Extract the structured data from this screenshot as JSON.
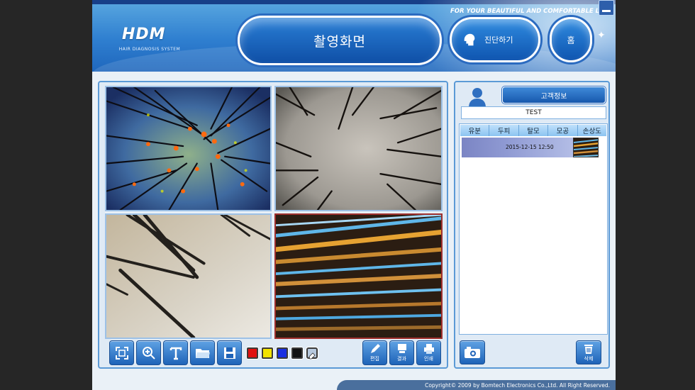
{
  "header": {
    "logo": "HDM",
    "logo_sub": "HAIR DIAGNOSIS SYSTEM",
    "slogan": "FOR YOUR BEAUTIFUL AND COMFORTABLE LIFE",
    "screen_title": "촬영화면",
    "diagnose_label": "진단하기",
    "home_label": "홈"
  },
  "toolbar": {
    "tools": [
      {
        "name": "fit-screen",
        "icon": "fit-screen-icon"
      },
      {
        "name": "zoom",
        "icon": "zoom-in-icon"
      },
      {
        "name": "text",
        "icon": "text-icon"
      },
      {
        "name": "open-folder",
        "icon": "folder-icon"
      },
      {
        "name": "save",
        "icon": "floppy-icon"
      }
    ],
    "colors": [
      "#e01010",
      "#f2e200",
      "#1a2fe0",
      "#111111"
    ],
    "edit_label": "편집",
    "result_label": "결과",
    "print_label": "인쇄"
  },
  "customer": {
    "title": "고객정보",
    "name": "TEST",
    "tabs": [
      "유분",
      "두피",
      "탈모",
      "모공",
      "손상도"
    ],
    "records": [
      {
        "datetime": "2015-12-15 12:50"
      }
    ],
    "camera_icon": "camera-icon",
    "delete_label": "삭제"
  },
  "footer": {
    "copyright": "Copyright© 2009 by Bomtech Electronics Co.,Ltd.  All Right Reserved."
  }
}
